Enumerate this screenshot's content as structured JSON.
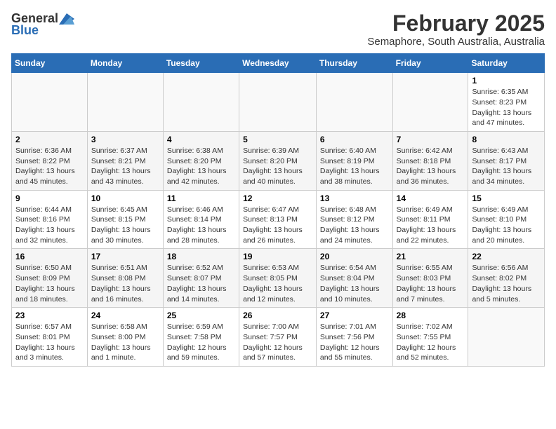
{
  "header": {
    "logo_general": "General",
    "logo_blue": "Blue",
    "title": "February 2025",
    "subtitle": "Semaphore, South Australia, Australia"
  },
  "weekdays": [
    "Sunday",
    "Monday",
    "Tuesday",
    "Wednesday",
    "Thursday",
    "Friday",
    "Saturday"
  ],
  "weeks": [
    [
      {
        "day": "",
        "info": ""
      },
      {
        "day": "",
        "info": ""
      },
      {
        "day": "",
        "info": ""
      },
      {
        "day": "",
        "info": ""
      },
      {
        "day": "",
        "info": ""
      },
      {
        "day": "",
        "info": ""
      },
      {
        "day": "1",
        "info": "Sunrise: 6:35 AM\nSunset: 8:23 PM\nDaylight: 13 hours and 47 minutes."
      }
    ],
    [
      {
        "day": "2",
        "info": "Sunrise: 6:36 AM\nSunset: 8:22 PM\nDaylight: 13 hours and 45 minutes."
      },
      {
        "day": "3",
        "info": "Sunrise: 6:37 AM\nSunset: 8:21 PM\nDaylight: 13 hours and 43 minutes."
      },
      {
        "day": "4",
        "info": "Sunrise: 6:38 AM\nSunset: 8:20 PM\nDaylight: 13 hours and 42 minutes."
      },
      {
        "day": "5",
        "info": "Sunrise: 6:39 AM\nSunset: 8:20 PM\nDaylight: 13 hours and 40 minutes."
      },
      {
        "day": "6",
        "info": "Sunrise: 6:40 AM\nSunset: 8:19 PM\nDaylight: 13 hours and 38 minutes."
      },
      {
        "day": "7",
        "info": "Sunrise: 6:42 AM\nSunset: 8:18 PM\nDaylight: 13 hours and 36 minutes."
      },
      {
        "day": "8",
        "info": "Sunrise: 6:43 AM\nSunset: 8:17 PM\nDaylight: 13 hours and 34 minutes."
      }
    ],
    [
      {
        "day": "9",
        "info": "Sunrise: 6:44 AM\nSunset: 8:16 PM\nDaylight: 13 hours and 32 minutes."
      },
      {
        "day": "10",
        "info": "Sunrise: 6:45 AM\nSunset: 8:15 PM\nDaylight: 13 hours and 30 minutes."
      },
      {
        "day": "11",
        "info": "Sunrise: 6:46 AM\nSunset: 8:14 PM\nDaylight: 13 hours and 28 minutes."
      },
      {
        "day": "12",
        "info": "Sunrise: 6:47 AM\nSunset: 8:13 PM\nDaylight: 13 hours and 26 minutes."
      },
      {
        "day": "13",
        "info": "Sunrise: 6:48 AM\nSunset: 8:12 PM\nDaylight: 13 hours and 24 minutes."
      },
      {
        "day": "14",
        "info": "Sunrise: 6:49 AM\nSunset: 8:11 PM\nDaylight: 13 hours and 22 minutes."
      },
      {
        "day": "15",
        "info": "Sunrise: 6:49 AM\nSunset: 8:10 PM\nDaylight: 13 hours and 20 minutes."
      }
    ],
    [
      {
        "day": "16",
        "info": "Sunrise: 6:50 AM\nSunset: 8:09 PM\nDaylight: 13 hours and 18 minutes."
      },
      {
        "day": "17",
        "info": "Sunrise: 6:51 AM\nSunset: 8:08 PM\nDaylight: 13 hours and 16 minutes."
      },
      {
        "day": "18",
        "info": "Sunrise: 6:52 AM\nSunset: 8:07 PM\nDaylight: 13 hours and 14 minutes."
      },
      {
        "day": "19",
        "info": "Sunrise: 6:53 AM\nSunset: 8:05 PM\nDaylight: 13 hours and 12 minutes."
      },
      {
        "day": "20",
        "info": "Sunrise: 6:54 AM\nSunset: 8:04 PM\nDaylight: 13 hours and 10 minutes."
      },
      {
        "day": "21",
        "info": "Sunrise: 6:55 AM\nSunset: 8:03 PM\nDaylight: 13 hours and 7 minutes."
      },
      {
        "day": "22",
        "info": "Sunrise: 6:56 AM\nSunset: 8:02 PM\nDaylight: 13 hours and 5 minutes."
      }
    ],
    [
      {
        "day": "23",
        "info": "Sunrise: 6:57 AM\nSunset: 8:01 PM\nDaylight: 13 hours and 3 minutes."
      },
      {
        "day": "24",
        "info": "Sunrise: 6:58 AM\nSunset: 8:00 PM\nDaylight: 13 hours and 1 minute."
      },
      {
        "day": "25",
        "info": "Sunrise: 6:59 AM\nSunset: 7:58 PM\nDaylight: 12 hours and 59 minutes."
      },
      {
        "day": "26",
        "info": "Sunrise: 7:00 AM\nSunset: 7:57 PM\nDaylight: 12 hours and 57 minutes."
      },
      {
        "day": "27",
        "info": "Sunrise: 7:01 AM\nSunset: 7:56 PM\nDaylight: 12 hours and 55 minutes."
      },
      {
        "day": "28",
        "info": "Sunrise: 7:02 AM\nSunset: 7:55 PM\nDaylight: 12 hours and 52 minutes."
      },
      {
        "day": "",
        "info": ""
      }
    ]
  ]
}
